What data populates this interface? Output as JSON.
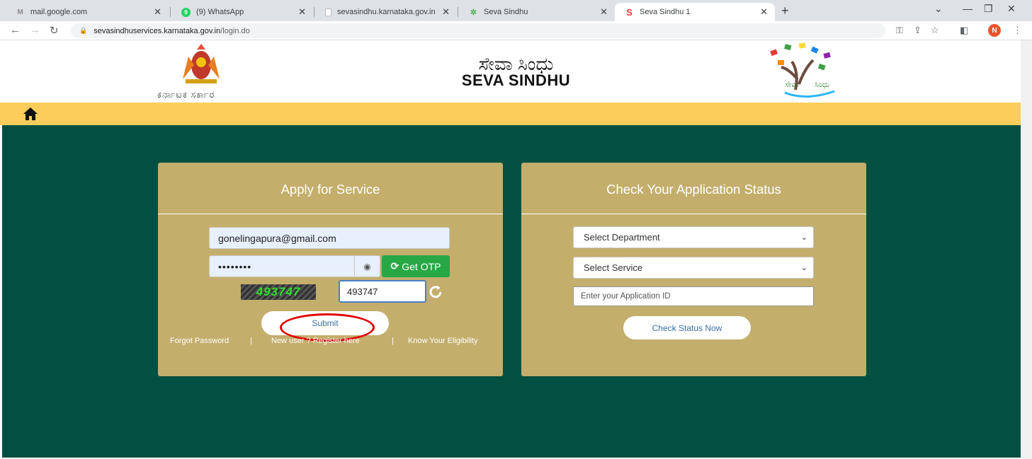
{
  "browser": {
    "tabs": [
      {
        "title": "mail.google.com",
        "icon": "gmail-icon"
      },
      {
        "title": "(9) WhatsApp",
        "icon": "whatsapp-icon"
      },
      {
        "title": "sevasindhu.karnataka.gov.in",
        "icon": "page-icon"
      },
      {
        "title": "Seva Sindhu",
        "icon": "seva-sindhu-icon"
      },
      {
        "title": "Seva Sindhu 1",
        "icon": "seva-sindhu-red-icon"
      }
    ],
    "active_tab_index": 4,
    "url_host": "sevasindhuservices.karnataka.gov.in",
    "url_path": "/login.do",
    "profile_initial": "N",
    "colors": {
      "tabbar": "#dee1e6",
      "profile": "#e8542b"
    }
  },
  "header": {
    "state_text": "ಕರ್ನಾಟಕ ಸರ್ಕಾರ",
    "title_kannada": "ಸೇವಾ ಸಿಂಧು",
    "title_english": "SEVA SINDHU"
  },
  "colors": {
    "nav_yellow": "#fbce5b",
    "main_green": "#025041",
    "panel_tan": "#c3ae6c",
    "otp_green": "#28a745",
    "highlight_red": "#e00000"
  },
  "apply_panel": {
    "title": "Apply for Service",
    "email_value": "gonelingapura@gmail.com",
    "password_mask": "••••••••",
    "get_otp_label": "Get OTP",
    "captcha_text": "493747",
    "captcha_input_value": "493747",
    "submit_label": "Submit",
    "links": {
      "forgot": "Forgot Password",
      "sep1": "|",
      "register": "New user ? Register here",
      "sep2": "|",
      "eligibility": "Know Your Eligibility"
    }
  },
  "status_panel": {
    "title": "Check Your Application Status",
    "department_select": "Select Department",
    "service_select": "Select Service",
    "application_id_placeholder": "Enter your Application ID",
    "check_button_label": "Check Status Now"
  }
}
